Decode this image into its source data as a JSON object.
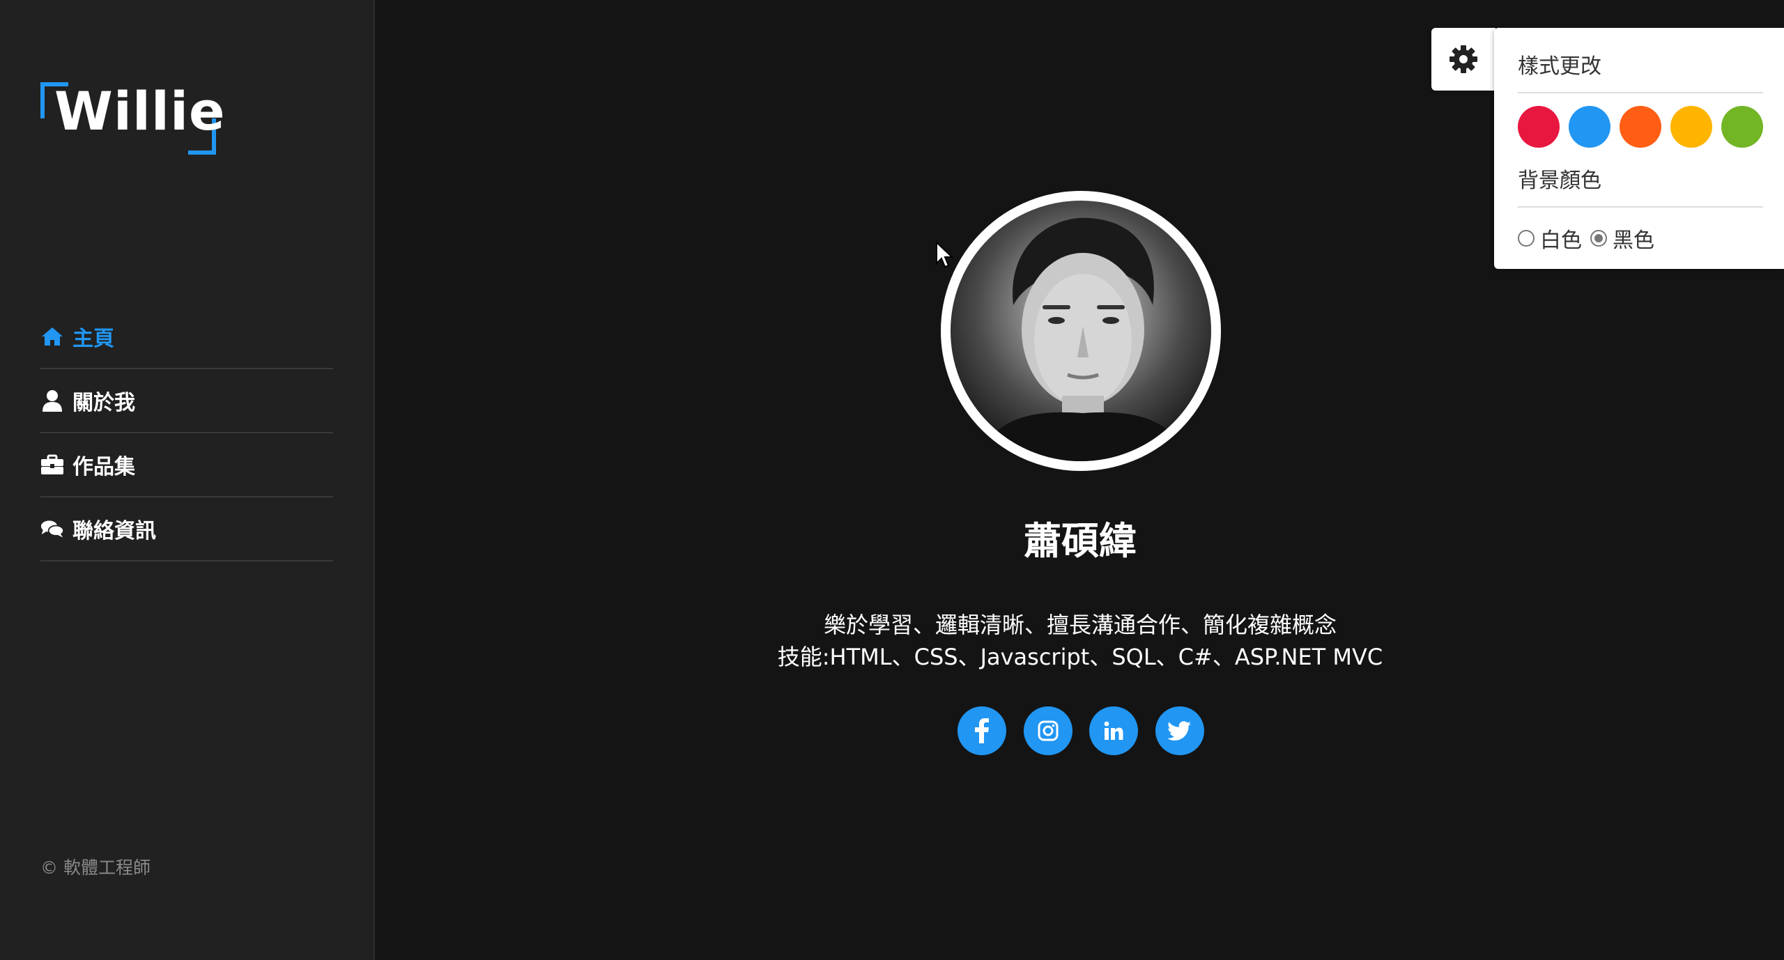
{
  "sidebar": {
    "logo_text": "Willie",
    "nav": [
      {
        "label": "主頁",
        "icon": "home-icon",
        "active": true
      },
      {
        "label": "關於我",
        "icon": "user-icon",
        "active": false
      },
      {
        "label": "作品集",
        "icon": "briefcase-icon",
        "active": false
      },
      {
        "label": "聯絡資訊",
        "icon": "comments-icon",
        "active": false
      }
    ],
    "footer": "© 軟體工程師"
  },
  "profile": {
    "name": "蕭碩緯",
    "description_line1": "樂於學習、邏輯清晰、擅長溝通合作、簡化複雜概念",
    "description_line2": "技能:HTML、CSS、Javascript、SQL、C#、ASP.NET MVC",
    "social": [
      {
        "icon": "facebook-icon"
      },
      {
        "icon": "instagram-icon"
      },
      {
        "icon": "linkedin-icon"
      },
      {
        "icon": "twitter-icon"
      }
    ]
  },
  "style_panel": {
    "title": "樣式更改",
    "colors": [
      "#e8173f",
      "#2196f3",
      "#ff5e14",
      "#ffb400",
      "#72b626"
    ],
    "background_title": "背景顏色",
    "background_options": [
      {
        "label": "白色",
        "checked": false
      },
      {
        "label": "黑色",
        "checked": true
      }
    ]
  },
  "theme": {
    "accent": "#2196f3",
    "sidebar_bg": "#212121",
    "main_bg": "#141414"
  }
}
